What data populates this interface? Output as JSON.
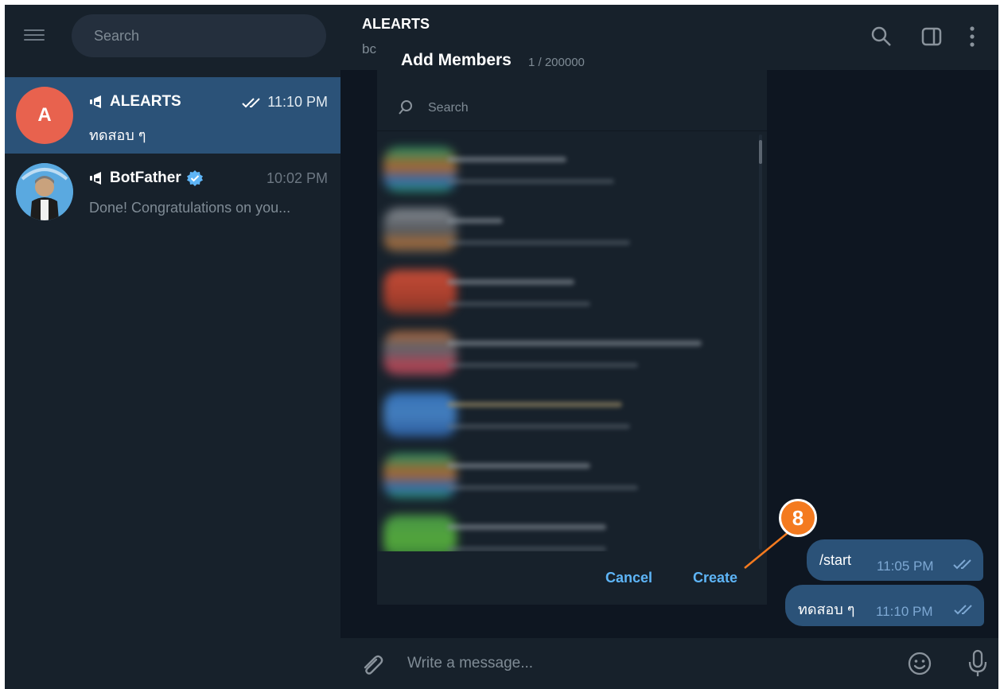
{
  "sidebar": {
    "search_placeholder": "Search",
    "chats": [
      {
        "name": "ALEARTS",
        "time": "11:10 PM",
        "preview": "ทดสอบ ๆ",
        "avatar_letter": "A",
        "avatar_color": "#e8624e"
      },
      {
        "name": "BotFather",
        "time": "10:02 PM",
        "preview": "Done! Congratulations on you..."
      }
    ]
  },
  "header": {
    "title": "ALEARTS",
    "subtitle": "bc"
  },
  "modal": {
    "title": "Add Members",
    "count": "1 / 200000",
    "search_placeholder": "Search",
    "cancel_label": "Cancel",
    "create_label": "Create"
  },
  "messages": [
    {
      "text": "/start",
      "time": "11:05 PM"
    },
    {
      "text": "ทดสอบ ๆ",
      "time": "11:10 PM"
    }
  ],
  "composer": {
    "placeholder": "Write a message..."
  },
  "annotation": {
    "step": "8",
    "color": "#f47a1f"
  },
  "colors": {
    "accent": "#5eb5f7",
    "sidebar_bg": "#17212b",
    "chat_bg": "#0e1621",
    "active_chat": "#2b5278",
    "bubble": "#2b5278"
  }
}
